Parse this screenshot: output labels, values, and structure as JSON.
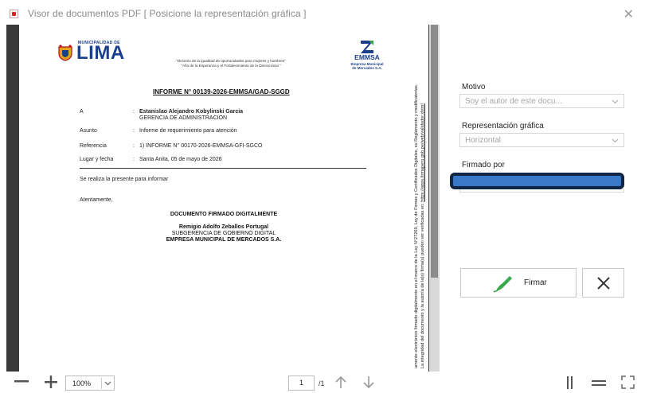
{
  "window": {
    "title": "Visor de documentos PDF [ Posicione la representación gráfica ]",
    "close_glyph": "✕"
  },
  "document": {
    "lima_logo_small": "MUNICIPALIDAD DE",
    "lima_logo_big": "LIMA",
    "decenio_line1": "\"Decenio de la igualdad de oportunidades para mujeres y hombres\"",
    "decenio_line2": "\"Año de la Esperanza y el Fortalecimiento de la Democracia \"",
    "emmsa_logo": "EMMSA",
    "emmsa_sub1": "Empresa Municipal",
    "emmsa_sub2": "de Mercados S.A.",
    "heading": "INFORME N° 00139-2026-EMMSA/GAD-SGGD",
    "fields": [
      {
        "label": "A",
        "value": "Estanislao Alejandro Kobylinski Garcia",
        "value2": "GERENCIA DE ADMINISTRACION"
      },
      {
        "label": "Asunto",
        "value": "Informe de requerimiento para atención"
      },
      {
        "label": "Referencia",
        "value": "1)   INFORME N° 00170-2026-EMMSA-GFI-SGCO"
      },
      {
        "label": "Lugar y fecha",
        "value": "Santa Anita, 05 de mayo de 2026"
      }
    ],
    "colon": ":",
    "body_text": "Se realiza la presente para informar",
    "closing": "Atentamente,",
    "signed_label": "DOCUMENTO FIRMADO DIGITALMENTE",
    "signer_name": "Remigio Adolfo Zeballos Portugal",
    "signer_dept": "SUBGERENCIA DE GOBIERNO DIGITAL",
    "signer_company": "EMPRESA MUNICIPAL DE MERCADOS S.A.",
    "vertical_line1": "umento electrónico firmado digitalmente en el marco de la Ley N°27269, Ley de Firmas y Certificados Digitales, su Reglamento y modificatorias.",
    "vertical_line2_a": "La integridad del documento y la autoría de la(s) firma(s) pueden ser verificadas en: ",
    "vertical_line2_link": "https://apps.firmaperu.gob.pe/web/validador.xhtml"
  },
  "toolbar": {
    "zoom_out_glyph": "—",
    "zoom_in_glyph": "+",
    "zoom_value": "100%",
    "page_current": "1",
    "page_total": "/1"
  },
  "panel": {
    "motivo_label": "Motivo",
    "motivo_value": "Soy el autor de este docu...",
    "representacion_label": "Representación gráfica",
    "representacion_value": "Horizontal",
    "firmado_label": "Firmado por",
    "firmar_label": "Firmar"
  },
  "colors": {
    "viewer_bg": "#3a3a3a",
    "signer_highlight": "#3a78c9",
    "signer_border": "#0f2645",
    "pen_green": "#3aa84a",
    "lima_blue": "#1a3f8c"
  }
}
